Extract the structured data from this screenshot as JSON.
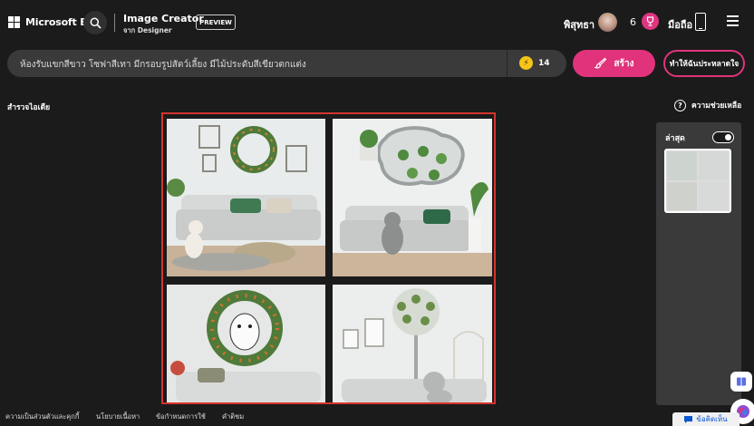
{
  "header": {
    "brand": "Microsoft Bing",
    "product_title": "Image Creator",
    "product_subtitle": "จาก Designer",
    "preview_badge": "PREVIEW",
    "user_name": "พิสุทธา",
    "boost_count": "6",
    "mobile_label": "มือถือ"
  },
  "prompt": {
    "text": "ห้องรับแขกสีขาว โซฟาสีเทา มีกรอบรูปสัตว์เลี้ยง มีไม้ประดับสีเขียวตกแต่ง",
    "boosts_remaining": "14"
  },
  "actions": {
    "create_label": "สร้าง",
    "surprise_label": "ทำให้ฉันประหลาดใจ"
  },
  "sections": {
    "explore_label": "สำรวจไอเดีย",
    "help_label": "ความช่วยเหลือ",
    "recent_label": "ล่าสุด"
  },
  "footer": {
    "links": [
      "ความเป็นส่วนตัวและคุกกี้",
      "นโยบายเนื้อหา",
      "ข้อกำหนดการใช้",
      "คำติชม"
    ],
    "feedback_label": "ข้อคิดเห็น"
  },
  "colors": {
    "accent": "#e0337b",
    "selection_border": "#d3342f",
    "background": "#1b1b1b",
    "panel": "#3a3a3a"
  }
}
